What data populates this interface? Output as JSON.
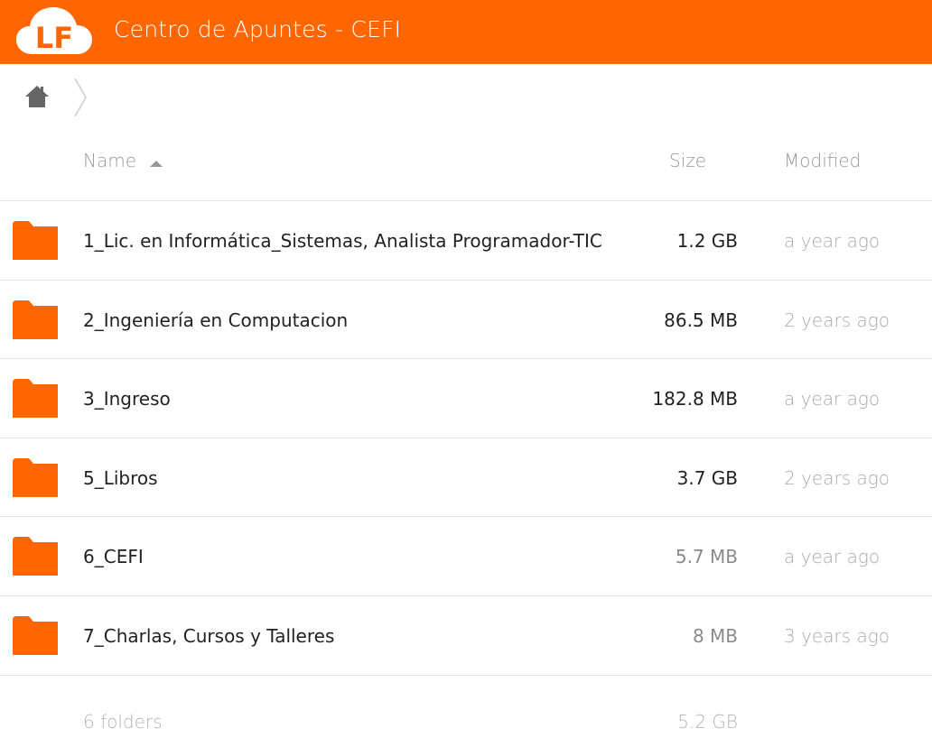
{
  "header": {
    "logo_text": "LF",
    "title": "Centro de Apuntes - CEFI",
    "brand_color": "#ff6600"
  },
  "breadcrumb": {
    "home_icon": "home-icon",
    "separator_icon": "chevron-right-icon"
  },
  "columns": {
    "name": "Name",
    "size": "Size",
    "modified": "Modified",
    "sort_icon": "sort-ascending-icon"
  },
  "rows": [
    {
      "icon": "folder-icon",
      "name": "1_Lic. en Informática_Sistemas, Analista Programador-TIC",
      "size": "1.2 GB",
      "modified": "a year ago"
    },
    {
      "icon": "folder-icon",
      "name": "2_Ingeniería en Computacion",
      "size": "86.5 MB",
      "modified": "2 years ago"
    },
    {
      "icon": "folder-icon",
      "name": "3_Ingreso",
      "size": "182.8 MB",
      "modified": "a year ago"
    },
    {
      "icon": "folder-icon",
      "name": "5_Libros",
      "size": "3.7 GB",
      "modified": "2 years ago"
    },
    {
      "icon": "folder-icon",
      "name": "6_CEFI",
      "size": "5.7 MB",
      "modified": "a year ago"
    },
    {
      "icon": "folder-icon",
      "name": "7_Charlas, Cursos y Talleres",
      "size": "8 MB",
      "modified": "3 years ago"
    }
  ],
  "footer": {
    "count": "6 folders",
    "total_size": "5.2 GB"
  }
}
